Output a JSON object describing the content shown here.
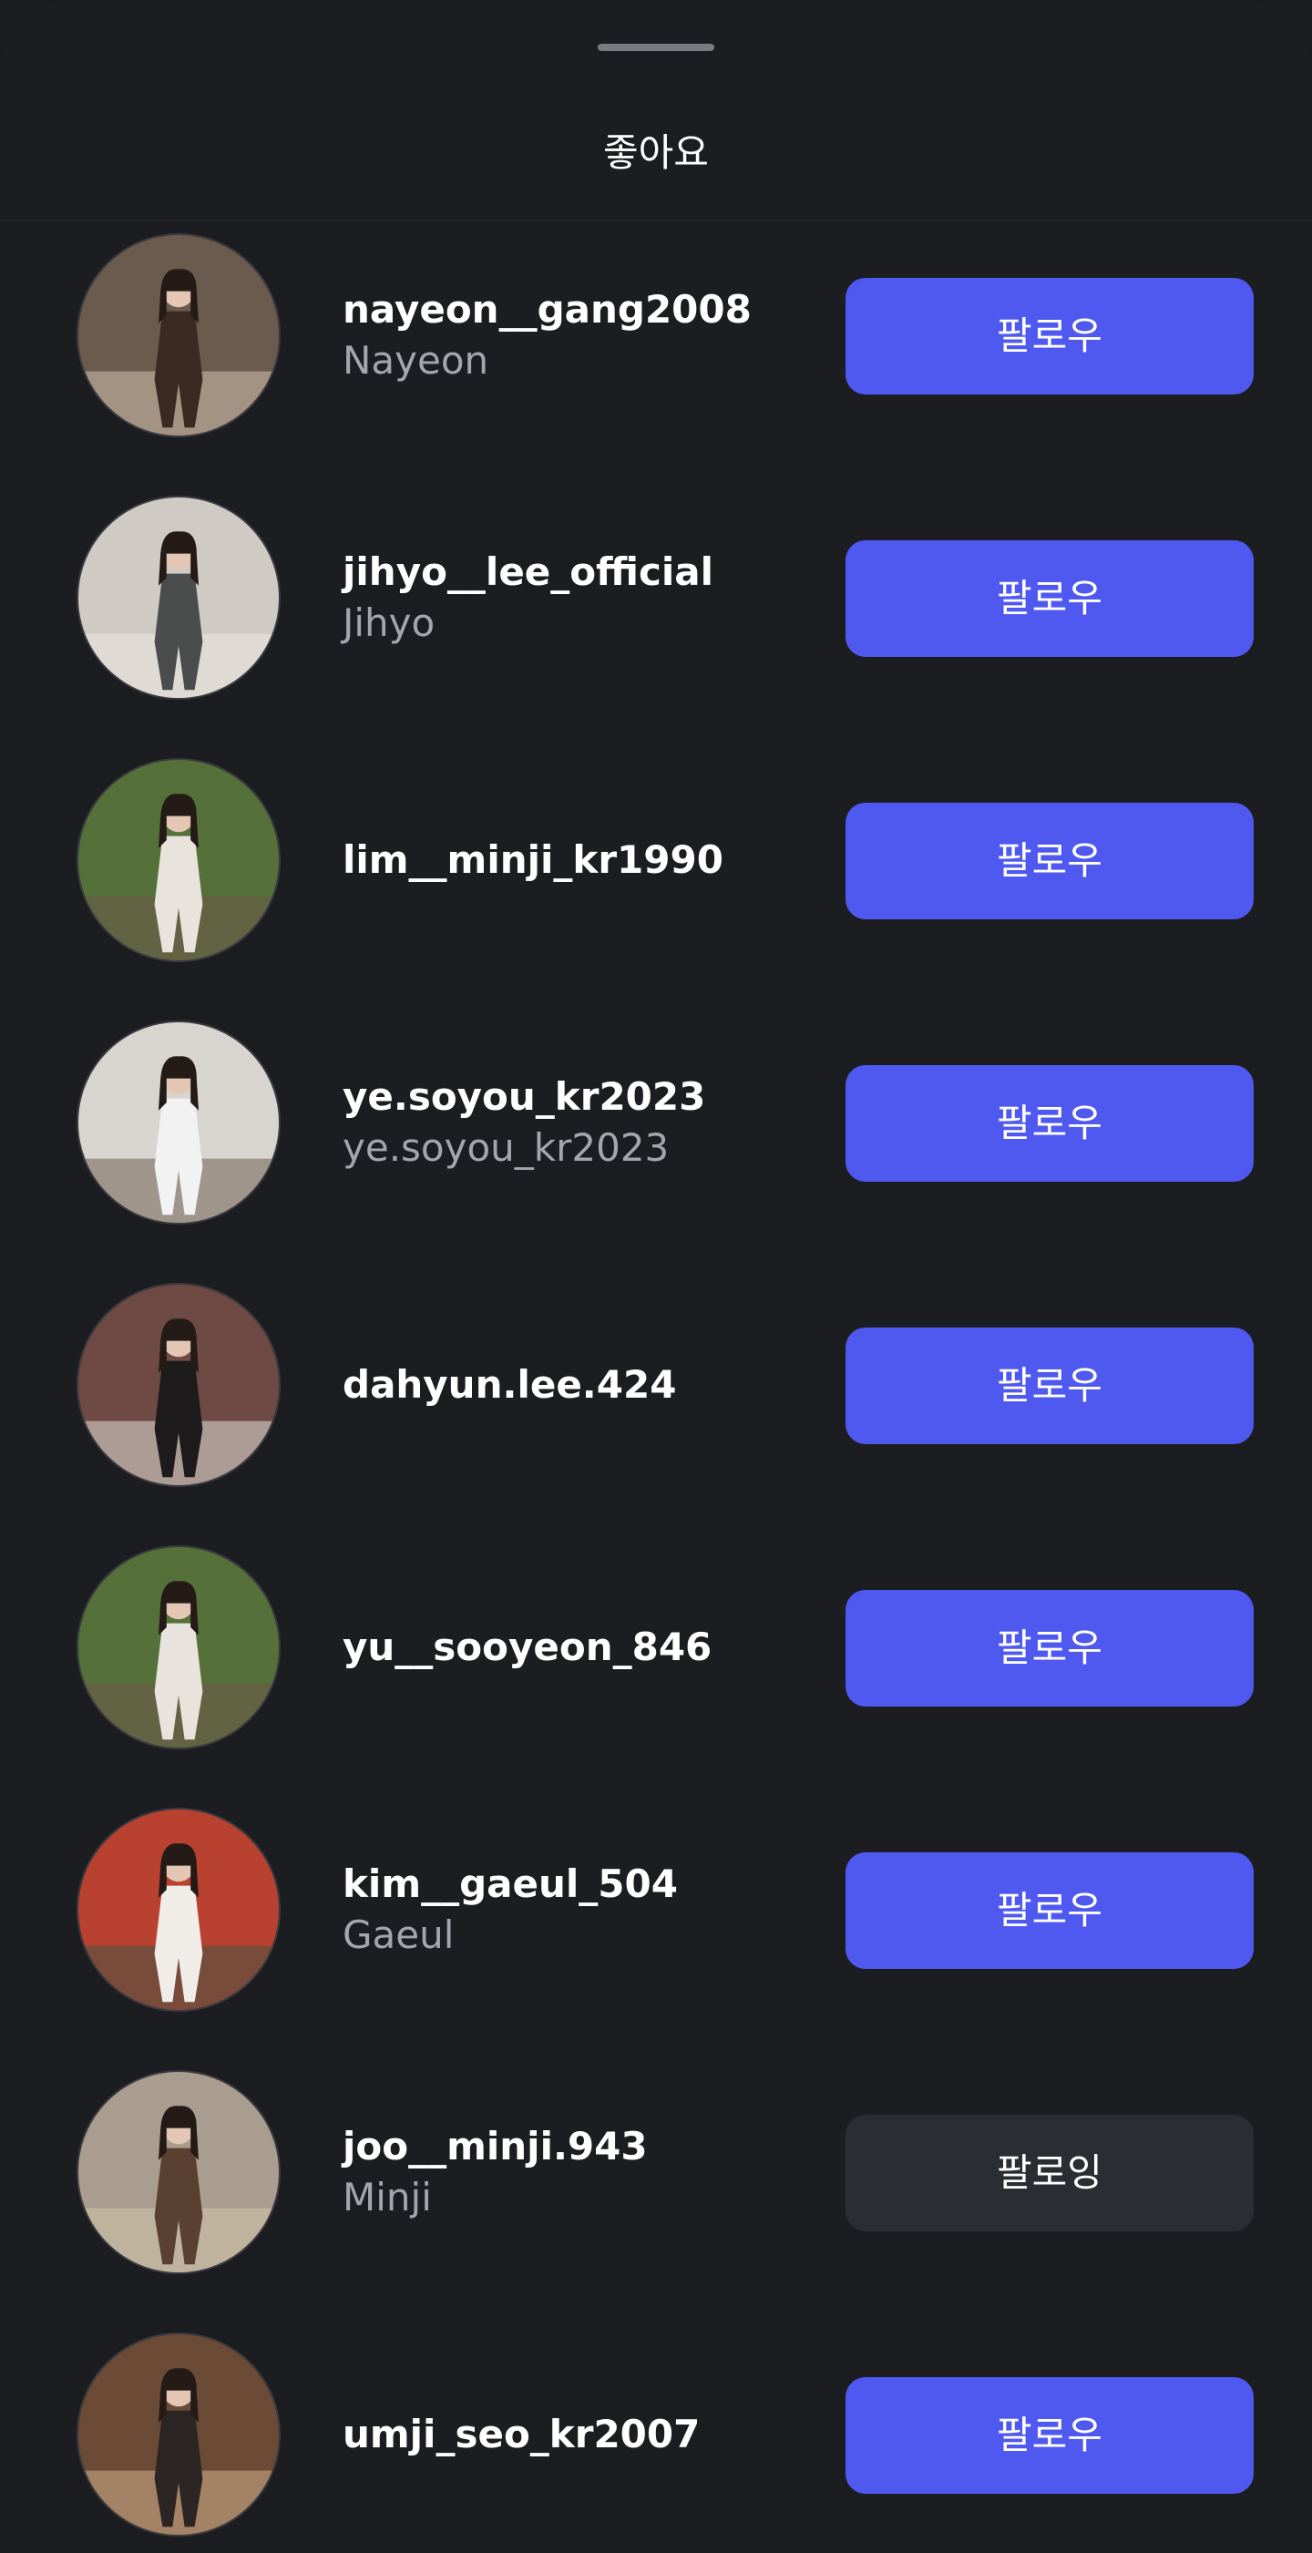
{
  "sheet": {
    "title": "좋아요"
  },
  "users": [
    {
      "username": "nayeon__gang2008",
      "name": "Nayeon",
      "button": "팔로우",
      "following": false,
      "bg": "#6b5a4e",
      "fg": "#3a2a22",
      "accent": "#c9b8a6"
    },
    {
      "username": "jihyo__lee_official",
      "name": "Jihyo",
      "button": "팔로우",
      "following": false,
      "bg": "#cfcac4",
      "fg": "#4b4d4c",
      "accent": "#e9e5df"
    },
    {
      "username": "lim__minji_kr1990",
      "name": "",
      "button": "팔로우",
      "following": false,
      "bg": "#56703a",
      "fg": "#e8e3dc",
      "accent": "#6a5a4a"
    },
    {
      "username": "ye.soyou_kr2023",
      "name": "ye.soyou_kr2023",
      "button": "팔로우",
      "following": false,
      "bg": "#d8d4cf",
      "fg": "#f2f2f2",
      "accent": "#7b6a5d"
    },
    {
      "username": "dahyun.lee.424",
      "name": "",
      "button": "팔로우",
      "following": false,
      "bg": "#6f4a44",
      "fg": "#1d1b1c",
      "accent": "#d7d2cc"
    },
    {
      "username": "yu__sooyeon_846",
      "name": "",
      "button": "팔로우",
      "following": false,
      "bg": "#56703a",
      "fg": "#e8e3dc",
      "accent": "#6a5a4a"
    },
    {
      "username": "kim__gaeul_504",
      "name": "Gaeul",
      "button": "팔로우",
      "following": false,
      "bg": "#b9412f",
      "fg": "#f0ede8",
      "accent": "#4d5245"
    },
    {
      "username": "joo__minji.943",
      "name": "Minji",
      "button": "팔로잉",
      "following": true,
      "bg": "#a89d8e",
      "fg": "#5a4030",
      "accent": "#d1c2a8"
    },
    {
      "username": "umji_seo_kr2007",
      "name": "",
      "button": "팔로우",
      "following": false,
      "bg": "#6b4a36",
      "fg": "#2b2523",
      "accent": "#c9a886"
    }
  ],
  "colors": {
    "background": "#1c1d21",
    "follow_button": "#5059ef",
    "following_button": "#2a2d31",
    "secondary_text": "#a4a6ad"
  }
}
